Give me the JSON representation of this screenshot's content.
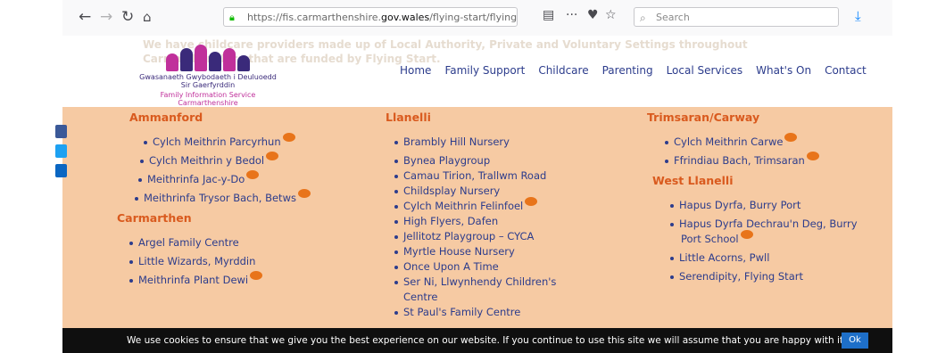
{
  "browser": {
    "back_icon": "back-arrow-icon",
    "url_prefix": "https://fis.carmarthenshire.",
    "url_domain": "gov.wales",
    "url_suffix": "/flying-start/flying-start-chil",
    "search_placeholder": "Search",
    "reader_glyph": "▤",
    "menu_glyph": "···",
    "pocket_glyph": "♥",
    "star_glyph": "☆",
    "download_glyph": "⤓"
  },
  "header": {
    "ghost_text_1": "We have childcare providers made up of Local Authority, Private and Voluntary Settings throughout",
    "ghost_text_2": "Carmarthenshire that are funded by Flying Start.",
    "logo": {
      "line1": "Gwasanaeth Gwybodaeth i Deuluoedd",
      "line2": "Sir Gaerfyrddin",
      "line3": "Family Information Service",
      "line4": "Carmarthenshire"
    },
    "menu": [
      "Home",
      "Family Support",
      "Childcare",
      "Parenting",
      "Local Services",
      "What's On",
      "Contact"
    ]
  },
  "columns": {
    "col1": {
      "heading1": "Ammanford",
      "items1": [
        "Cylch Meithrin Parcyrhun",
        "Cylch Meithrin y Bedol",
        "Meithrinfa Jac-y-Do",
        "Meithrinfa Trysor Bach, Betws"
      ],
      "heading2": "Carmarthen",
      "items2": [
        "Argel Family Centre",
        "Little Wizards, Myrddin",
        "Meithrinfa Plant Dewi"
      ]
    },
    "col2": {
      "heading1": "Llanelli",
      "items1": [
        "Brambly Hill Nursery",
        "Bynea Playgroup",
        "Camau Tirion, Trallwm Road",
        "Childsplay Nursery",
        "Cylch Meithrin Felinfoel",
        "High Flyers, Dafen",
        "Jellitotz Playgroup – CYCA",
        "Myrtle House Nursery",
        "Once Upon A Time",
        "Ser Ni, Llwynhendy Children's",
        "St Paul's Family Centre"
      ],
      "item_wrap": "Centre"
    },
    "col3": {
      "heading1": "Trimsaran/Carway",
      "items1": [
        "Cylch Meithrin Carwe",
        "Ffrindiau Bach, Trimsaran"
      ],
      "heading2": "West Llanelli",
      "items2": [
        "Hapus Dyrfa, Burry Port",
        "Hapus Dyrfa Dechrau'n Deg, Burry",
        "Little Acorns, Pwll",
        "Serendipity, Flying Start"
      ],
      "item_wrap": "Port School"
    }
  },
  "cookie": {
    "text": "We use cookies to ensure that we give you the best experience on our website. If you continue to use this site we will assume that you are happy with it.",
    "ok_label": "Ok"
  },
  "colors": {
    "accent_orange": "#e8741a",
    "heading_orange": "#d95a1e",
    "link_navy": "#2c3c8c",
    "content_bg": "#f6caa3"
  }
}
